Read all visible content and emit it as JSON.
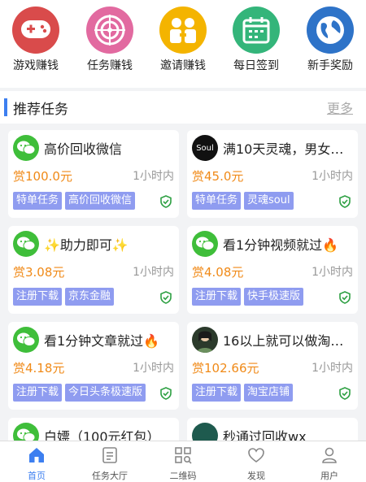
{
  "shortcuts": [
    {
      "label": "游戏赚钱",
      "color": "#d94b4b",
      "icon": "gamepad-icon"
    },
    {
      "label": "任务赚钱",
      "color": "#e26aa0",
      "icon": "target-icon"
    },
    {
      "label": "邀请赚钱",
      "color": "#f4b400",
      "icon": "invite-people-icon"
    },
    {
      "label": "每日签到",
      "color": "#34b57a",
      "icon": "calendar-icon"
    },
    {
      "label": "新手奖励",
      "color": "#2e73c8",
      "icon": "globe-icon"
    }
  ],
  "section": {
    "title": "推荐任务",
    "more": "更多"
  },
  "cards": [
    {
      "title": "高价回收微信",
      "reward": "赏100.0元",
      "time": "1小时内",
      "tags": [
        "特单任务",
        "高价回收微信"
      ],
      "avatar": "wechat-avatar"
    },
    {
      "title": "满10天灵魂，男女…",
      "reward": "赏45.0元",
      "time": "1小时内",
      "tags": [
        "特单任务",
        "灵魂soul"
      ],
      "avatar": "soul-avatar",
      "avatar_text": "Soul"
    },
    {
      "title": "✨助力即可✨",
      "reward": "赏3.08元",
      "time": "1小时内",
      "tags": [
        "注册下载",
        "京东金融"
      ],
      "avatar": "wechat-avatar"
    },
    {
      "title": "看1分钟视频就过🔥",
      "reward": "赏4.08元",
      "time": "1小时内",
      "tags": [
        "注册下载",
        "快手极速版"
      ],
      "avatar": "wechat-avatar"
    },
    {
      "title": "看1分钟文章就过🔥",
      "reward": "赏4.18元",
      "time": "1小时内",
      "tags": [
        "注册下载",
        "今日头条极速版"
      ],
      "avatar": "wechat-avatar"
    },
    {
      "title": "16以上就可以做淘…",
      "reward": "赏102.66元",
      "time": "1小时内",
      "tags": [
        "注册下载",
        "淘宝店铺"
      ],
      "avatar": "person-avatar"
    },
    {
      "title": "白嫖（100元红包）",
      "avatar": "wechat-avatar"
    },
    {
      "title": "秒通过回收wx",
      "avatar": "green-avatar"
    }
  ],
  "tabs": [
    {
      "label": "首页",
      "icon": "home-icon",
      "active": true
    },
    {
      "label": "任务大厅",
      "icon": "task-list-icon"
    },
    {
      "label": "二维码",
      "icon": "qrcode-icon"
    },
    {
      "label": "发现",
      "icon": "heart-icon"
    },
    {
      "label": "用户",
      "icon": "user-icon"
    }
  ],
  "colors": {
    "accent": "#3d7ff0",
    "reward": "#f08a18",
    "tag": "#8f9cf0",
    "shield": "#2ea043"
  }
}
